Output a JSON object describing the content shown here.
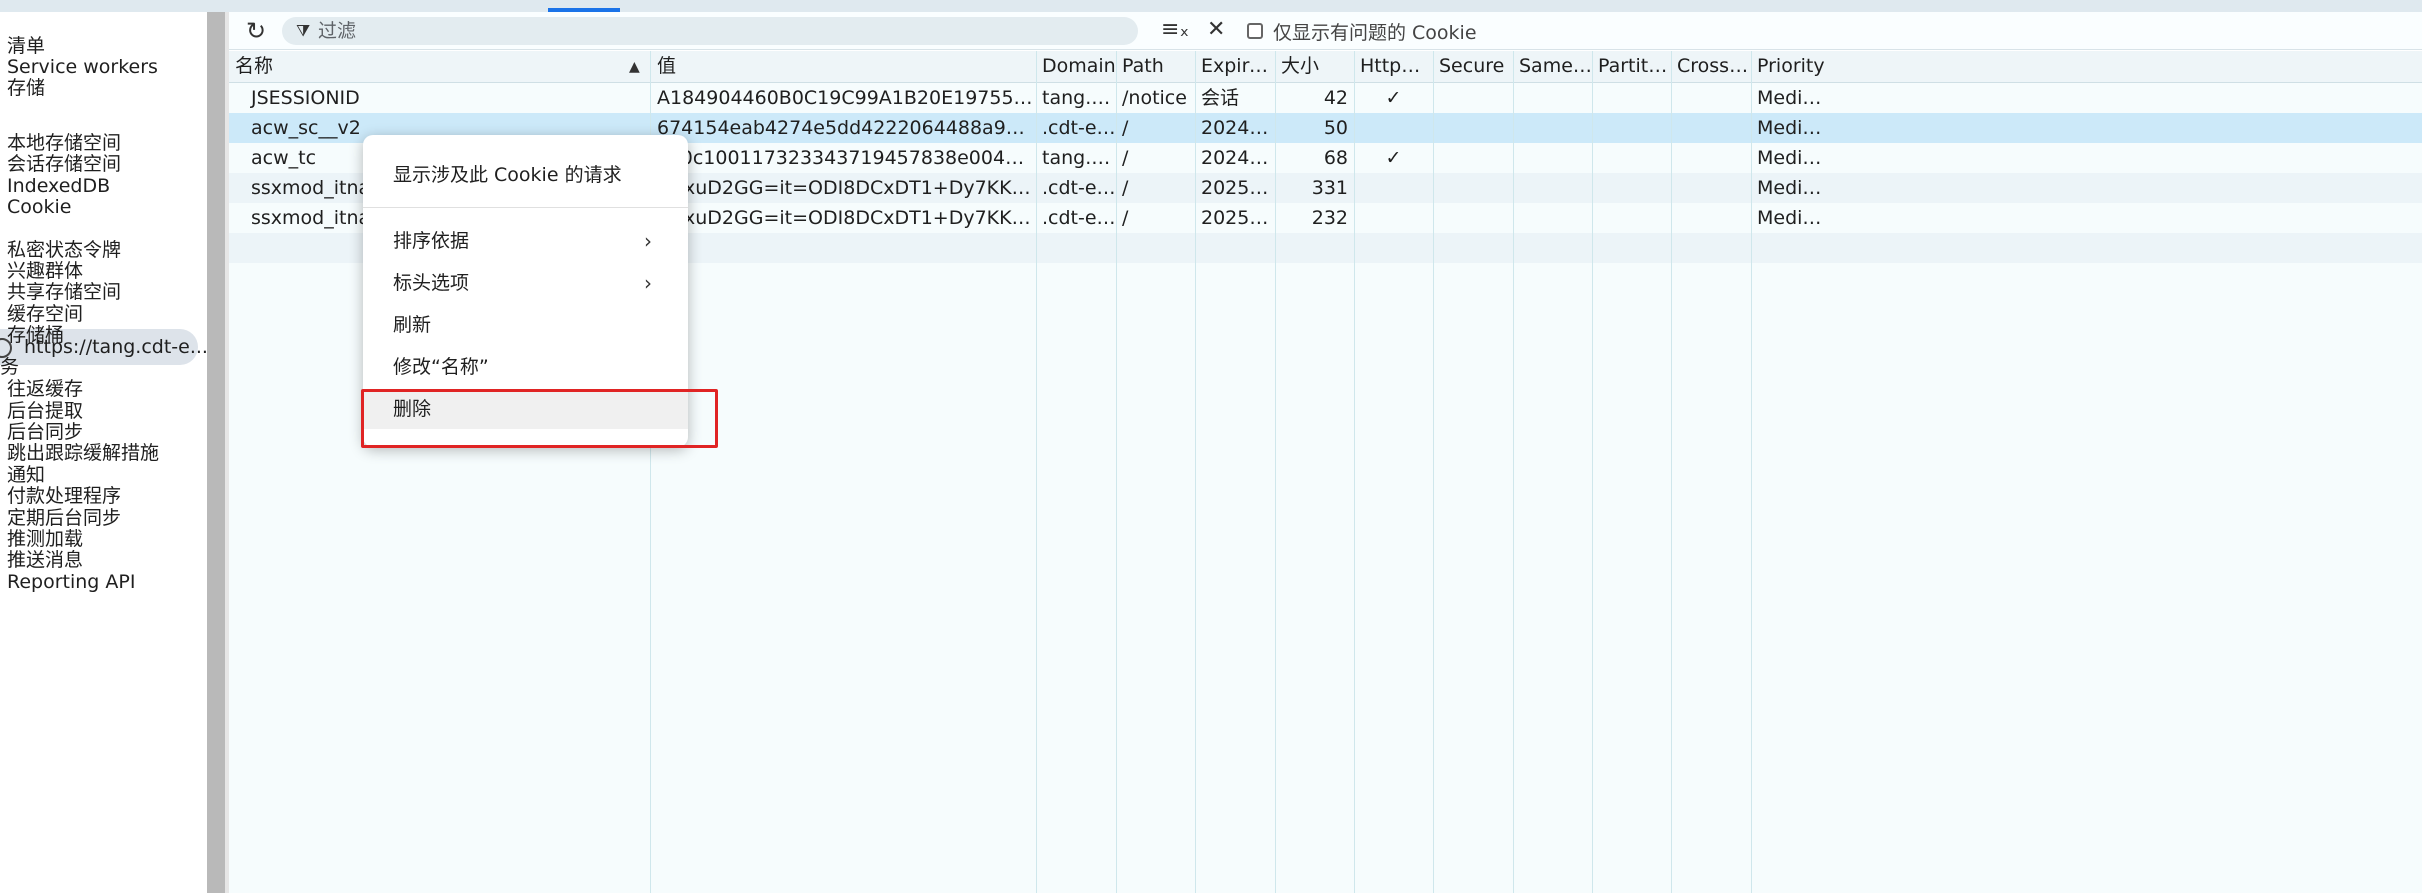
{
  "sidebar": {
    "items_top": [
      "清单",
      "Service workers",
      "存储"
    ],
    "storage_items": [
      "本地存储空间",
      "会话存储空间",
      "IndexedDB",
      "Cookie"
    ],
    "selected_cookie_origin": "https://tang.cdt-e...",
    "storage_items_after": [
      "私密状态令牌",
      "兴趣群体",
      "共享存储空间",
      "缓存空间",
      "存储桶"
    ],
    "section_label": "务",
    "service_items": [
      "往返缓存",
      "后台提取",
      "后台同步",
      "跳出跟踪缓解措施",
      "通知",
      "付款处理程序",
      "定期后台同步",
      "推测加载",
      "推送消息",
      "Reporting API"
    ]
  },
  "toolbar": {
    "filter_placeholder": "过滤",
    "only_issues_label": "仅显示有问题的 Cookie"
  },
  "table": {
    "columns": [
      "名称",
      "值",
      "Domain",
      "Path",
      "Expires / ...",
      "大小",
      "HttpOnly",
      "Secure",
      "SameSite",
      "Partition K...",
      "Cross Site",
      "Priority"
    ],
    "rows": [
      {
        "name": "JSESSIONID",
        "value": "A184904460B0C19C99A1B20E19755B70",
        "domain": "tang.cdt-e...",
        "path": "/notice",
        "expires": "会话",
        "size": "42",
        "httponly": "✓",
        "secure": "",
        "samesite": "",
        "partition": "",
        "cross": "",
        "priority": "Medium"
      },
      {
        "name": "acw_sc__v2",
        "value": "674154eab4274e5dd4222064488a91f5d96b3796",
        "domain": ".cdt-ec.com",
        "path": "/",
        "expires": "2024-11-2...",
        "size": "50",
        "httponly": "",
        "secure": "",
        "samesite": "",
        "partition": "",
        "cross": "",
        "priority": "Medium"
      },
      {
        "name": "acw_tc",
        "value": "1a0c100117323343719457838e004315b17ef1968bba0525d046c7...",
        "domain": "tang.cdt-e...",
        "path": "/",
        "expires": "2024-11-2...",
        "size": "68",
        "httponly": "✓",
        "secure": "",
        "samesite": "",
        "partition": "",
        "cross": "",
        "priority": "Medium"
      },
      {
        "name": "ssxmod_itna",
        "value": "QqxuD2GG=it=ODI8DCxDT1+Dy7KKKDnDGq24xReAe4DsYebDSx...",
        "domain": ".cdt-ec.com",
        "path": "/",
        "expires": "2025-05-2...",
        "size": "331",
        "httponly": "",
        "secure": "",
        "samesite": "",
        "partition": "",
        "cross": "",
        "priority": "Medium"
      },
      {
        "name": "ssxmod_itna2",
        "value": "QqxuD2GG=it=ODI8DCxDT1+Dy7KKKDnDGq24xReYikjeHYmYDIh...",
        "domain": ".cdt-ec.com",
        "path": "/",
        "expires": "2025-05-2...",
        "size": "232",
        "httponly": "",
        "secure": "",
        "samesite": "",
        "partition": "",
        "cross": "",
        "priority": "Medium"
      }
    ]
  },
  "context_menu": {
    "items": [
      "显示涉及此 Cookie 的请求",
      "排序依据",
      "标头选项",
      "刷新",
      "修改“名称”",
      "删除"
    ]
  },
  "colors": {
    "selected_row": "#cce9f9",
    "highlight_border": "#e02424",
    "accent": "#1a73e8"
  }
}
